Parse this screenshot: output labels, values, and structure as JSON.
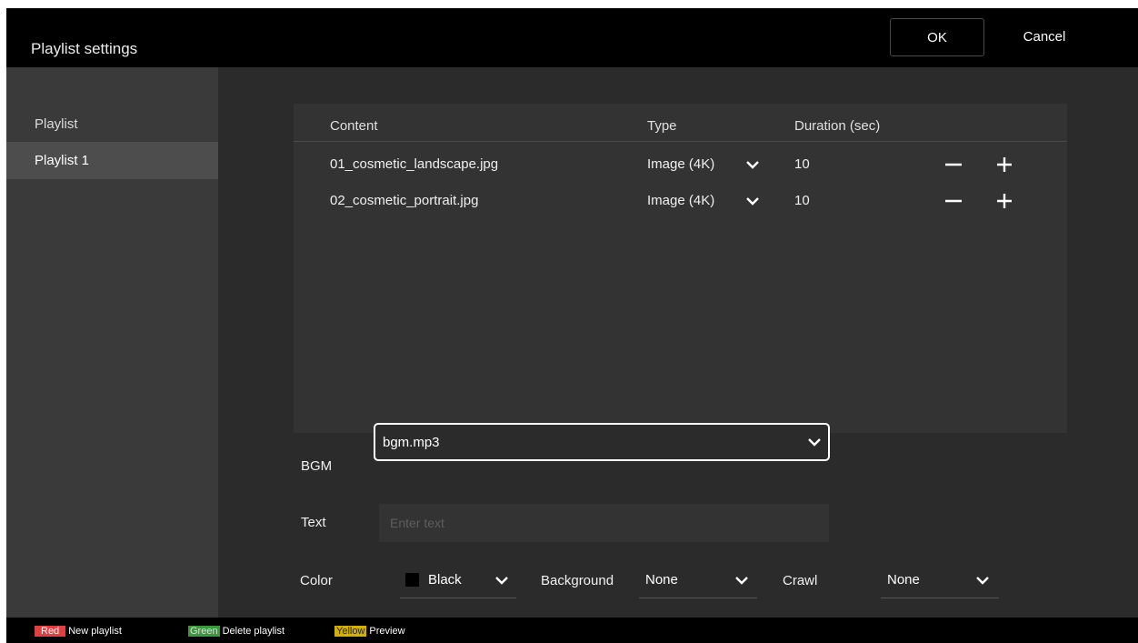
{
  "header": {
    "title": "Playlist settings",
    "ok_label": "OK",
    "cancel_label": "Cancel"
  },
  "sidebar": {
    "heading": "Playlist",
    "items": [
      {
        "label": "Playlist 1",
        "selected": true
      }
    ]
  },
  "table": {
    "columns": {
      "content": "Content",
      "type": "Type",
      "duration": "Duration (sec)"
    },
    "rows": [
      {
        "content": "01_cosmetic_landscape.jpg",
        "type": "Image (4K)",
        "duration": "10"
      },
      {
        "content": "02_cosmetic_portrait.jpg",
        "type": "Image (4K)",
        "duration": "10"
      }
    ]
  },
  "bgm": {
    "label": "BGM",
    "value": "bgm.mp3"
  },
  "text": {
    "label": "Text",
    "placeholder": "Enter text",
    "value": ""
  },
  "color": {
    "label": "Color",
    "value": "Black"
  },
  "background": {
    "label": "Background",
    "value": "None"
  },
  "crawl": {
    "label": "Crawl",
    "value": "None"
  },
  "footer": {
    "red": {
      "key": "Red",
      "label": "New playlist"
    },
    "green": {
      "key": "Green",
      "label": "Delete playlist"
    },
    "yellow": {
      "key": "Yellow",
      "label": "Preview"
    }
  },
  "icons": {
    "dropdown": "chevron-down-icon",
    "decrement": "minus-icon",
    "increment": "plus-icon"
  }
}
